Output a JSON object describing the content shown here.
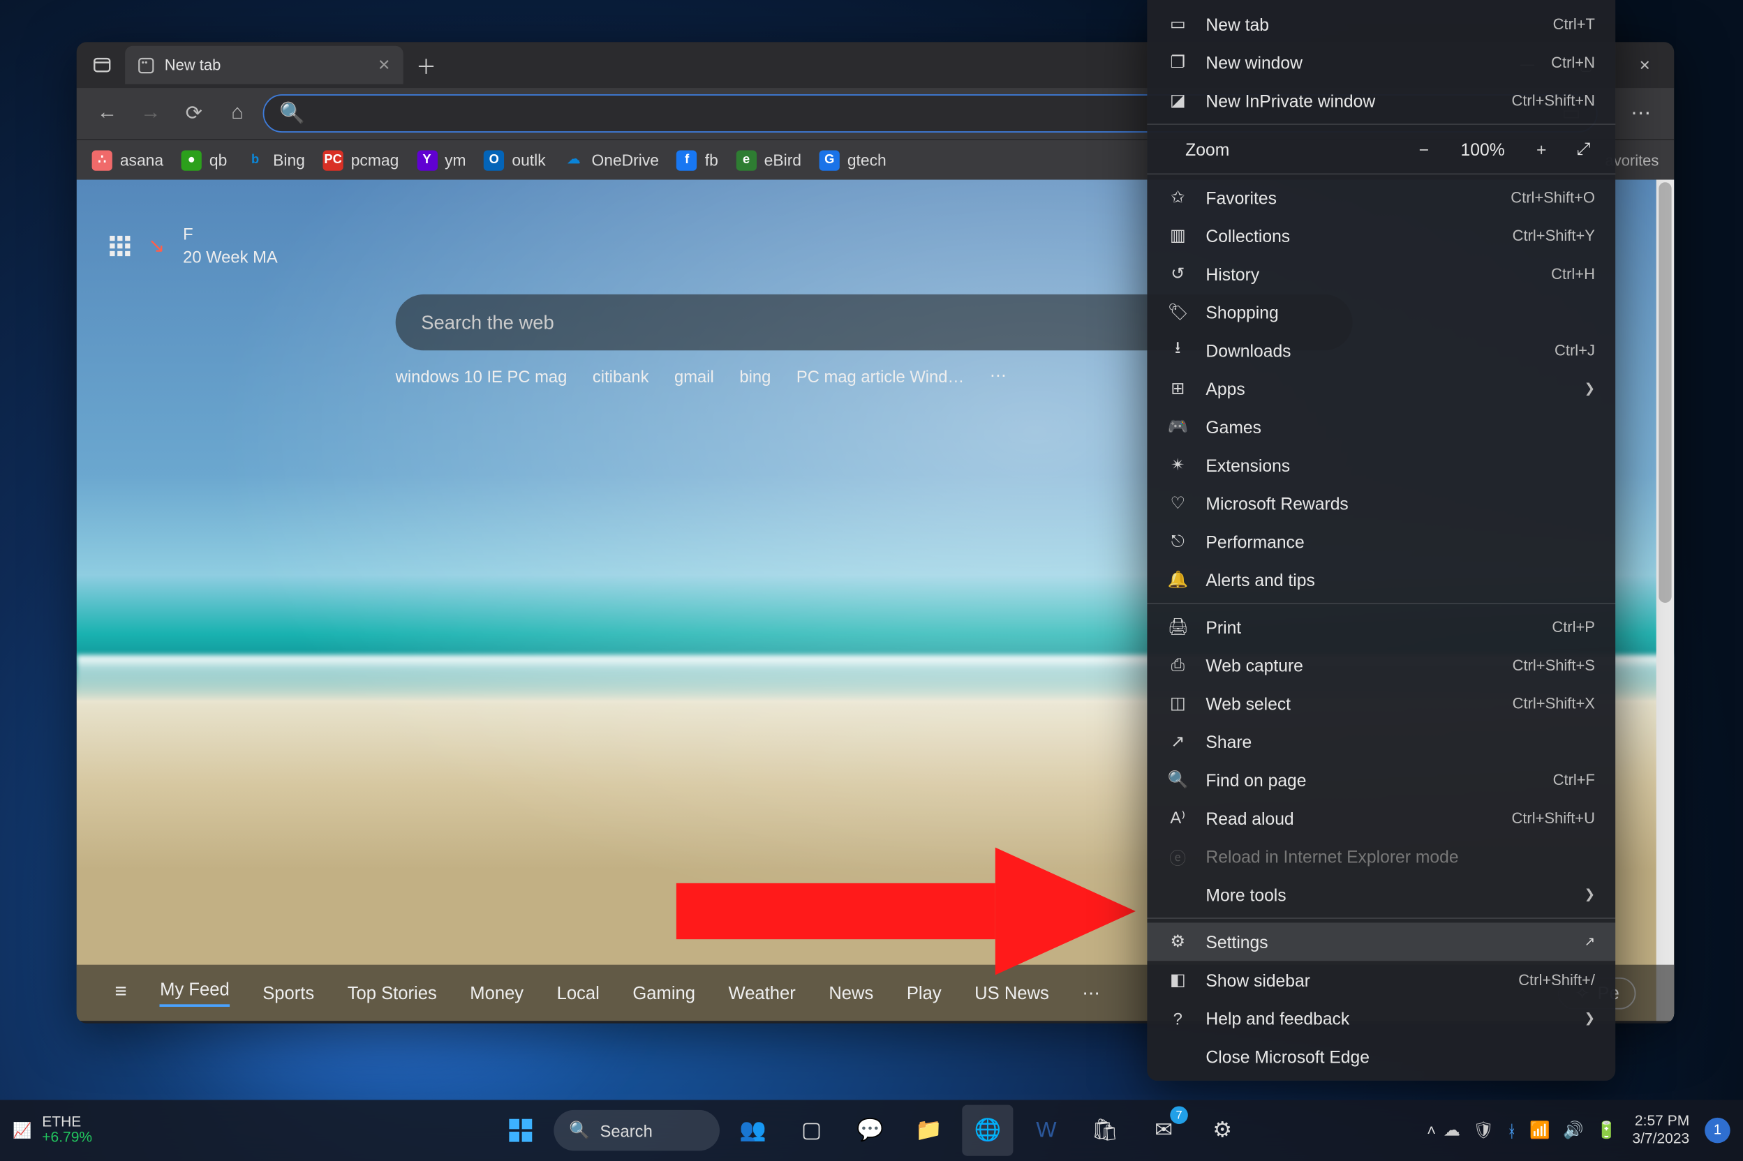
{
  "tab": {
    "title": "New tab"
  },
  "window_controls": {
    "min": "—",
    "max": "▢",
    "close": "✕"
  },
  "address_bar": {
    "value": ""
  },
  "favorites_bar": {
    "items": [
      {
        "label": "asana",
        "color": "#f06a6a"
      },
      {
        "label": "qb",
        "color": "#2ca01c"
      },
      {
        "label": "Bing",
        "color": "#0b88da"
      },
      {
        "label": "pcmag",
        "color": "#d93025"
      },
      {
        "label": "ym",
        "color": "#6001d2"
      },
      {
        "label": "outlk",
        "color": "#0364b8"
      },
      {
        "label": "OneDrive",
        "color": "#0a84d8"
      },
      {
        "label": "fb",
        "color": "#1877f2"
      },
      {
        "label": "eBird",
        "color": "#2e7d32"
      },
      {
        "label": "gtech",
        "color": "#1a73e8"
      }
    ],
    "trailing": "avorites"
  },
  "ntp": {
    "stock_symbol": "F",
    "stock_sub": "20 Week MA",
    "search_placeholder": "Search the web",
    "quick_links": [
      "windows 10 IE PC mag",
      "citibank",
      "gmail",
      "bing",
      "PC mag article Wind…"
    ]
  },
  "feedbar": {
    "items": [
      "My Feed",
      "Sports",
      "Top Stories",
      "Money",
      "Local",
      "Gaming",
      "Weather",
      "News",
      "Play",
      "US News"
    ],
    "personalize": "Pe"
  },
  "menu": {
    "new_tab": {
      "label": "New tab",
      "shortcut": "Ctrl+T"
    },
    "new_window": {
      "label": "New window",
      "shortcut": "Ctrl+N"
    },
    "new_inprivate": {
      "label": "New InPrivate window",
      "shortcut": "Ctrl+Shift+N"
    },
    "zoom": {
      "label": "Zoom",
      "value": "100%"
    },
    "favorites": {
      "label": "Favorites",
      "shortcut": "Ctrl+Shift+O"
    },
    "collections": {
      "label": "Collections",
      "shortcut": "Ctrl+Shift+Y"
    },
    "history": {
      "label": "History",
      "shortcut": "Ctrl+H"
    },
    "shopping": {
      "label": "Shopping"
    },
    "downloads": {
      "label": "Downloads",
      "shortcut": "Ctrl+J"
    },
    "apps": {
      "label": "Apps"
    },
    "games": {
      "label": "Games"
    },
    "extensions": {
      "label": "Extensions"
    },
    "rewards": {
      "label": "Microsoft Rewards"
    },
    "performance": {
      "label": "Performance"
    },
    "alerts": {
      "label": "Alerts and tips"
    },
    "print": {
      "label": "Print",
      "shortcut": "Ctrl+P"
    },
    "web_capture": {
      "label": "Web capture",
      "shortcut": "Ctrl+Shift+S"
    },
    "web_select": {
      "label": "Web select",
      "shortcut": "Ctrl+Shift+X"
    },
    "share": {
      "label": "Share"
    },
    "find": {
      "label": "Find on page",
      "shortcut": "Ctrl+F"
    },
    "read_aloud": {
      "label": "Read aloud",
      "shortcut": "Ctrl+Shift+U"
    },
    "reload_ie": {
      "label": "Reload in Internet Explorer mode"
    },
    "more_tools": {
      "label": "More tools"
    },
    "settings": {
      "label": "Settings"
    },
    "show_sidebar": {
      "label": "Show sidebar",
      "shortcut": "Ctrl+Shift+/"
    },
    "help": {
      "label": "Help and feedback"
    },
    "close_edge": {
      "label": "Close Microsoft Edge"
    }
  },
  "taskbar": {
    "stock": {
      "symbol": "ETHE",
      "change": "+6.79%"
    },
    "search_placeholder": "Search",
    "clock": {
      "time": "2:57 PM",
      "date": "3/7/2023"
    },
    "notif_count": "1",
    "mail_badge": "7"
  }
}
